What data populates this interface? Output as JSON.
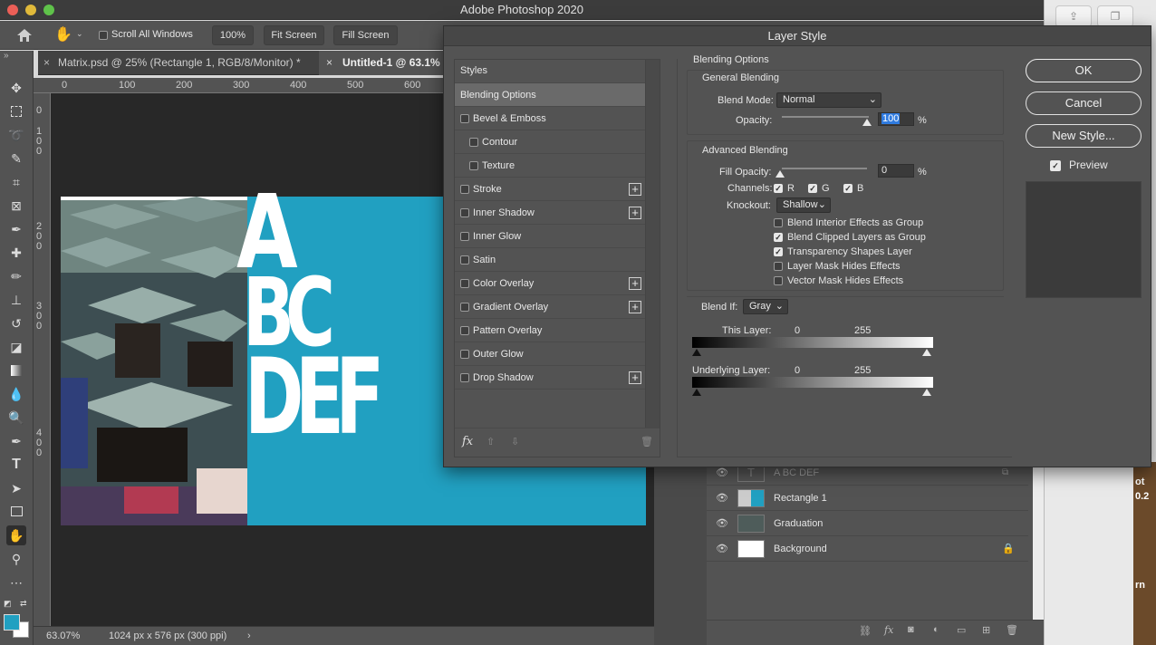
{
  "app": {
    "title": "Adobe Photoshop 2020"
  },
  "options": {
    "scroll_all_windows": "Scroll All Windows",
    "zoom": "100%",
    "fit_screen": "Fit Screen",
    "fill_screen": "Fill Screen"
  },
  "tabs": [
    {
      "label": "Matrix.psd @ 25% (Rectangle 1, RGB/8/Monitor) *"
    },
    {
      "label": "Untitled-1 @ 63.1%"
    }
  ],
  "ruler": {
    "top_ticks": [
      "0",
      "100",
      "200",
      "300",
      "400",
      "500",
      "600"
    ],
    "left_ticks": [
      "0",
      "1 0 0",
      "2 0 0",
      "3 0 0",
      "4 0 0"
    ]
  },
  "artwork": {
    "line1": "A",
    "line2": "BC",
    "line3": "DEF",
    "accent_color": "#21a0c1"
  },
  "status": {
    "zoom": "63.07%",
    "dimensions": "1024 px x 576 px (300 ppi)"
  },
  "dialog": {
    "title": "Layer Style",
    "styles_header": "Styles",
    "style_items": [
      {
        "label": "Blending Options",
        "selected": true,
        "checkbox": false,
        "indent": false,
        "plus": false
      },
      {
        "label": "Bevel & Emboss",
        "checkbox": true,
        "indent": false,
        "plus": false
      },
      {
        "label": "Contour",
        "checkbox": true,
        "indent": true,
        "plus": false
      },
      {
        "label": "Texture",
        "checkbox": true,
        "indent": true,
        "plus": false
      },
      {
        "label": "Stroke",
        "checkbox": true,
        "indent": false,
        "plus": true
      },
      {
        "label": "Inner Shadow",
        "checkbox": true,
        "indent": false,
        "plus": true
      },
      {
        "label": "Inner Glow",
        "checkbox": true,
        "indent": false,
        "plus": false
      },
      {
        "label": "Satin",
        "checkbox": true,
        "indent": false,
        "plus": false
      },
      {
        "label": "Color Overlay",
        "checkbox": true,
        "indent": false,
        "plus": true
      },
      {
        "label": "Gradient Overlay",
        "checkbox": true,
        "indent": false,
        "plus": true
      },
      {
        "label": "Pattern Overlay",
        "checkbox": true,
        "indent": false,
        "plus": false
      },
      {
        "label": "Outer Glow",
        "checkbox": true,
        "indent": false,
        "plus": false
      },
      {
        "label": "Drop Shadow",
        "checkbox": true,
        "indent": false,
        "plus": true
      }
    ],
    "fx_label": "fx",
    "blending_options": "Blending Options",
    "general_blending": "General Blending",
    "blend_mode_label": "Blend Mode:",
    "blend_mode_value": "Normal",
    "opacity_label": "Opacity:",
    "opacity_value": "100",
    "percent": "%",
    "advanced_blending": "Advanced Blending",
    "fill_opacity_label": "Fill Opacity:",
    "fill_opacity_value": "0",
    "channels_label": "Channels:",
    "channel_r": "R",
    "channel_g": "G",
    "channel_b": "B",
    "knockout_label": "Knockout:",
    "knockout_value": "Shallow",
    "options": [
      {
        "label": "Blend Interior Effects as Group",
        "checked": false
      },
      {
        "label": "Blend Clipped Layers as Group",
        "checked": true
      },
      {
        "label": "Transparency Shapes Layer",
        "checked": true
      },
      {
        "label": "Layer Mask Hides Effects",
        "checked": false
      },
      {
        "label": "Vector Mask Hides Effects",
        "checked": false
      }
    ],
    "blend_if_label": "Blend If:",
    "blend_if_value": "Gray",
    "this_layer_label": "This Layer:",
    "this_layer_min": "0",
    "this_layer_max": "255",
    "underlying_label": "Underlying Layer:",
    "underlying_min": "0",
    "underlying_max": "255",
    "ok": "OK",
    "cancel": "Cancel",
    "new_style": "New Style...",
    "preview": "Preview"
  },
  "layers": [
    {
      "name": "A BC DEF",
      "type": "text",
      "dim": true
    },
    {
      "name": "Rectangle 1",
      "type": "shape",
      "dim": false
    },
    {
      "name": "Graduation",
      "type": "image",
      "dim": false
    },
    {
      "name": "Background",
      "type": "background",
      "dim": false,
      "locked": true
    }
  ],
  "bg_window_text": {
    "t1": "ot",
    "t2": "0.2",
    "t3": "rn"
  }
}
